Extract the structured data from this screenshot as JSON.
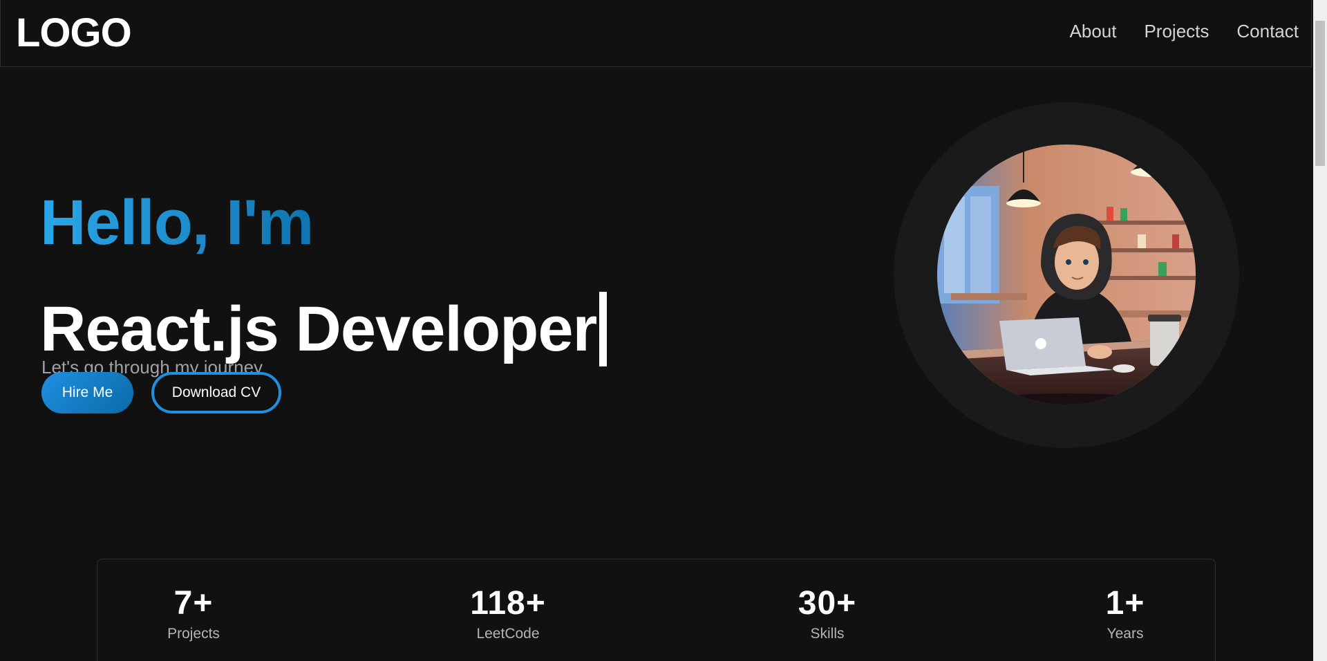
{
  "header": {
    "logo": "LOGO",
    "nav": [
      "About",
      "Projects",
      "Contact"
    ]
  },
  "hero": {
    "greeting": "Hello, I'm",
    "role": "React.js Developer",
    "tagline": "Let's go through my journey",
    "hire_button": "Hire Me",
    "cv_button": "Download CV"
  },
  "stats": [
    {
      "value": "7+",
      "label": "Projects"
    },
    {
      "value": "118+",
      "label": "LeetCode"
    },
    {
      "value": "30+",
      "label": "Skills"
    },
    {
      "value": "1+",
      "label": "Years"
    }
  ],
  "colors": {
    "background": "#111111",
    "accent": "#1e90e0",
    "text_muted": "#a1a1aa"
  }
}
